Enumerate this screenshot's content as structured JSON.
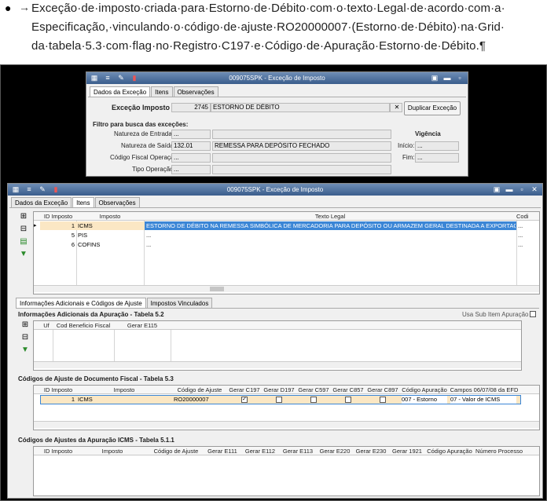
{
  "doc": {
    "line1": "Exceção·de·imposto·criada·para·Estorno·de·Débito·com·o·texto·Legal·de·acordo·com·a·",
    "line2": "Especificação,·vinculando·o·código·de·ajuste·RO20000007·(Estorno·de·Débito)·na·Grid·",
    "line3": "da·tabela·5.3·com·flag·no·Registro·C197·e·Código·de·Apuração·Estorno·de·Débito.¶",
    "bullet": "●",
    "arrow": "→"
  },
  "win1": {
    "title": "009075SPK - Exceção de Imposto",
    "tabs": [
      "Dados da Exceção",
      "Itens",
      "Observações"
    ],
    "excecao_label": "Exceção Imposto",
    "excecao_code": "2745",
    "excecao_desc": "ESTORNO DE DÉBITO",
    "clear": "✕",
    "dup_button": "Duplicar Exceção",
    "filtro_title": "Filtro para busca das exceções:",
    "rows": [
      {
        "label": "Natureza de Entrada:",
        "code": "...",
        "desc": ""
      },
      {
        "label": "Natureza de Saída:",
        "code": "132.01",
        "desc": "REMESSA PARA DEPÓSITO FECHADO"
      },
      {
        "label": "Código Fiscal Operação:",
        "code": "...",
        "desc": ""
      },
      {
        "label": "Tipo Operação:",
        "code": "...",
        "desc": ""
      }
    ],
    "vigencia": "Vigência",
    "inicio": "Início:",
    "fim": "Fim:",
    "dots": "..."
  },
  "win2": {
    "title": "009075SPK - Exceção de Imposto",
    "tabs": [
      "Dados da Exceção",
      "Itens",
      "Observações"
    ],
    "grid1": {
      "headers": [
        "ID Imposto",
        "Imposto",
        "Texto Legal",
        "Codi"
      ],
      "rows": [
        {
          "id": "1",
          "imp": "ICMS",
          "texto": "ESTORNO DE DÉBITO NA REMESSA SIMBÓLICA DE MERCADORIA PARA DEPÓSITO OU ARMAZEM GERAL DESTINADA A EXPORTAÇÃO - CONDER",
          "end": "..."
        },
        {
          "id": "5",
          "imp": "PIS",
          "texto": "...",
          "end": "..."
        },
        {
          "id": "6",
          "imp": "COFINS",
          "texto": "...",
          "end": "..."
        }
      ]
    },
    "subtabs": [
      "Informações Adicionais e Códigos de Ajuste",
      "Impostos Vinculados"
    ],
    "info_title": "Informações Adicionais da Apuração - Tabela 5.2",
    "usa_sub": "Usa Sub Item Apuração",
    "info_headers": [
      "Uf",
      "Cod Beneficio Fiscal",
      "Gerar E115"
    ],
    "ajuste_title": "Códigos de Ajuste de Documento Fiscal - Tabela 5.3",
    "ajuste_headers": [
      "ID Imposto",
      "Imposto",
      "Código de Ajuste",
      "Gerar C197",
      "Gerar D197",
      "Gerar C597",
      "Gerar C857",
      "Gerar C897",
      "Código Apuração",
      "Campos 06/07/08 da EFD"
    ],
    "ajuste_row": {
      "id": "1",
      "imp": "ICMS",
      "cod": "RO20000007",
      "c197": "✓",
      "apur": "007 - Estorno",
      "campos": "07 - Valor de ICMS"
    },
    "apur_title": "Códigos de Ajustes da Apuração ICMS - Tabela 5.1.1",
    "apur_headers": [
      "ID Imposto",
      "Imposto",
      "Código de Ajuste",
      "Gerar E111",
      "Gerar E112",
      "Gerar E113",
      "Gerar E220",
      "Gerar E230",
      "Gerar 1921",
      "Código Apuração",
      "Número Processo"
    ]
  }
}
